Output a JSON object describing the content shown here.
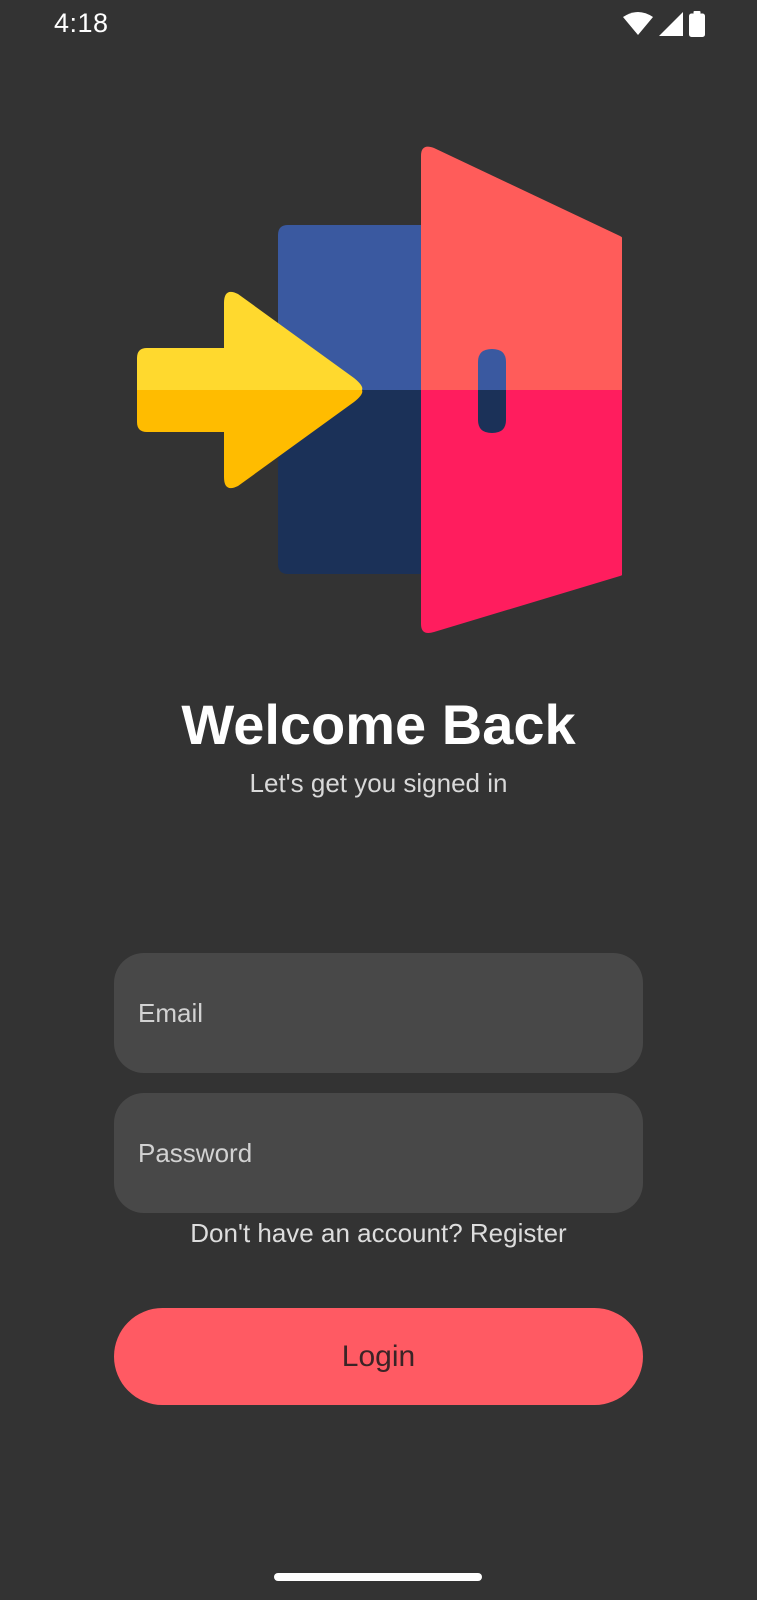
{
  "status_bar": {
    "time": "4:18",
    "icons": [
      "wifi-icon",
      "cellular-signal-icon",
      "battery-icon"
    ]
  },
  "hero": {
    "icon": "login-door-arrow-illustration",
    "colors": {
      "door_top": "#ff5c5a",
      "door_bottom": "#ff1d5e",
      "frame_top": "#3a59a0",
      "frame_bottom": "#1b3158",
      "arrow_top": "#ffd92e",
      "arrow_bottom": "#ffbc00"
    }
  },
  "header": {
    "title": "Welcome Back",
    "subtitle": "Let's get you signed in"
  },
  "form": {
    "email_placeholder": "Email",
    "email_value": "",
    "password_placeholder": "Password",
    "password_value": "",
    "register_text": "Don't have an account? Register",
    "login_label": "Login"
  },
  "theme": {
    "background": "#333333",
    "field_background": "#484848",
    "accent": "#ff5a63"
  }
}
